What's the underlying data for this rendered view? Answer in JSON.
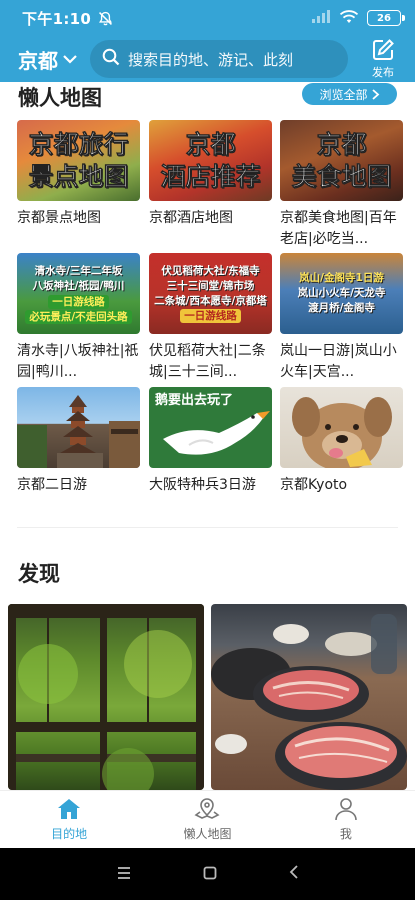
{
  "status": {
    "time": "下午1:10",
    "battery": "26"
  },
  "header": {
    "city": "京都",
    "search_placeholder": "搜索目的地、游记、此刻",
    "publish_label": "发布"
  },
  "lazy_map": {
    "title": "懒人地图",
    "browse_all": "浏览全部",
    "tiles": [
      {
        "caption": "京都景点地图",
        "line1": "京都旅行",
        "line2": "景点地图"
      },
      {
        "caption": "京都酒店地图",
        "line1": "京都",
        "line2": "酒店推荐"
      },
      {
        "caption": "京都美食地图|百年老店|必吃当...",
        "line1": "京都",
        "line2": "美食地图"
      },
      {
        "caption": "清水寺|八坂神社|祇园|鸭川...",
        "row1": "清水寺/三年二年坂",
        "row2": "八坂神社/祇园/鸭川",
        "pill1": "一日游线路",
        "pill2": "必玩景点/不走回头路"
      },
      {
        "caption": "伏见稻荷大社|二条城|三十三间...",
        "row1": "伏见稻荷大社/东福寺",
        "row2": "三十三间堂/锦市场",
        "row3": "二条城/西本愿寺/京都塔",
        "pill1": "一日游线路"
      },
      {
        "caption": "岚山一日游|岚山小火车|天宫...",
        "row1": "岚山/金阁寺1日游",
        "row2": "岚山小火车/天龙寺",
        "row3": "渡月桥/金阁寺"
      },
      {
        "caption": "京都二日游"
      },
      {
        "caption": "大阪特种兵3日游",
        "line1": "鹅要出去玩了"
      },
      {
        "caption": "京都Kyoto"
      }
    ]
  },
  "discover": {
    "title": "发现"
  },
  "bottom_nav": [
    {
      "label": "目的地",
      "icon": "home-icon"
    },
    {
      "label": "懒人地图",
      "icon": "map-pin-icon"
    },
    {
      "label": "我",
      "icon": "person-icon"
    }
  ],
  "colors": {
    "accent": "#35a4d6"
  }
}
